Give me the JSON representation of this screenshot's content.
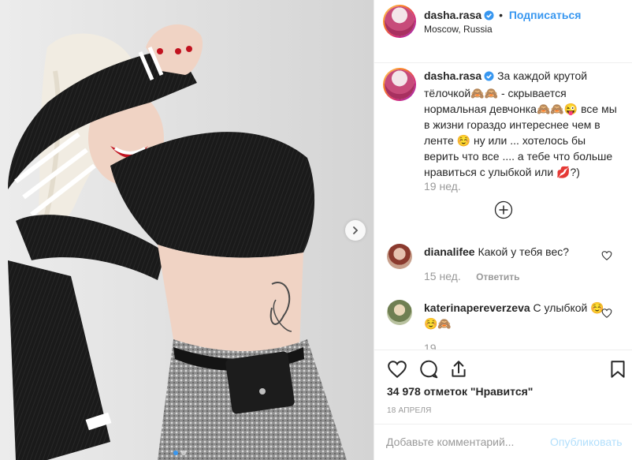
{
  "post": {
    "username": "dasha.rasa",
    "follow_label": "Подписаться",
    "location": "Moscow, Russia",
    "caption": "За каждой крутой тёлочкой🙈🙈 - скрывается нормальная девчонка🙈🙈😜 все мы в жизни гораздо интереснее чем в ленте ☺️ ну или ... хотелось бы верить что все .... а тебе что больше нравиться с улыбкой или 💋?)",
    "caption_time": "19 нед.",
    "likes": "34 978 отметок \"Нравится\"",
    "date": "18 АПРЕЛЯ",
    "comment_placeholder": "Добавьте комментарий...",
    "publish_label": "Опубликовать",
    "carousel": {
      "slides": 2,
      "current": 1
    }
  },
  "comments": [
    {
      "username": "dianalifee",
      "text": "Какой у тебя вес?",
      "time": "15 нед.",
      "reply_label": "Ответить"
    },
    {
      "username": "katerinapereverzeva",
      "text": "С улыбкой ☺️☺️🙈",
      "time": "19"
    }
  ],
  "colors": {
    "accent": "#3897f0",
    "text": "#262626",
    "muted": "#999999",
    "border": "#efefef",
    "publish_disabled": "#b2dffc"
  },
  "icons": [
    "chevron-right-icon",
    "verified-icon",
    "plus-circle-icon",
    "heart-icon",
    "comment-icon",
    "share-icon",
    "bookmark-icon"
  ]
}
